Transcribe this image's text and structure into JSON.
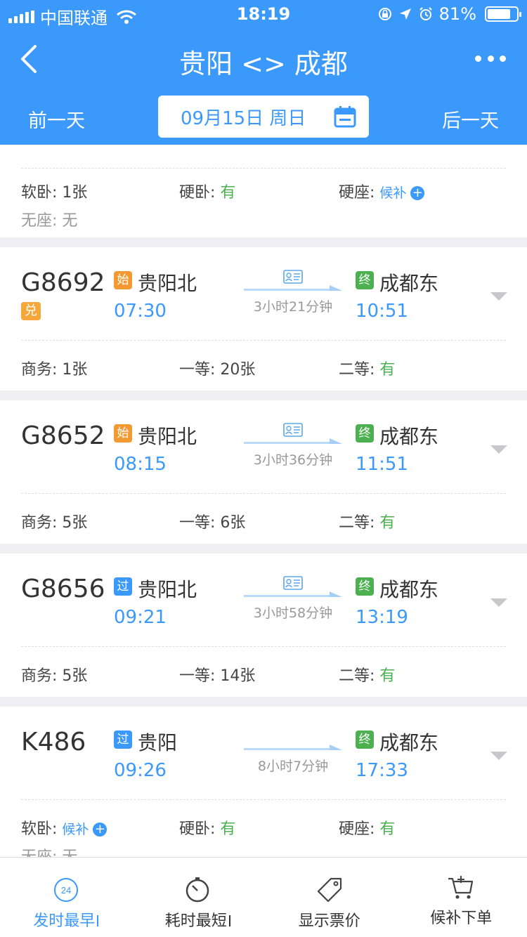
{
  "status": {
    "carrier": "中国联通",
    "time": "18:19",
    "battery": "81%",
    "battery_level": 0.81
  },
  "nav": {
    "title": "贵阳 <> 成都"
  },
  "datebar": {
    "prev": "前一天",
    "date": "09月15日 周日",
    "next": "后一天"
  },
  "partial_card": {
    "seats": [
      {
        "label": "软卧:",
        "value": "1张",
        "type": "normal"
      },
      {
        "label": "硬卧:",
        "value": "有",
        "type": "green"
      },
      {
        "label": "硬座:",
        "value": "候补",
        "type": "wait"
      }
    ],
    "seats2": [
      {
        "label": "无座:",
        "value": "无",
        "type": "gray"
      }
    ]
  },
  "trains": [
    {
      "no": "G8692",
      "exchange": "兑",
      "dep_badge": "始",
      "dep_badge_color": "orange",
      "dep_station": "贵阳北",
      "dep_time": "07:30",
      "duration": "3小时21分钟",
      "id_icon": true,
      "arr_badge": "终",
      "arr_station": "成都东",
      "arr_time": "10:51",
      "seats": [
        {
          "label": "商务:",
          "value": "1张",
          "type": "normal"
        },
        {
          "label": "一等:",
          "value": "20张",
          "type": "normal"
        },
        {
          "label": "二等:",
          "value": "有",
          "type": "green"
        }
      ]
    },
    {
      "no": "G8652",
      "exchange": "",
      "dep_badge": "始",
      "dep_badge_color": "orange",
      "dep_station": "贵阳北",
      "dep_time": "08:15",
      "duration": "3小时36分钟",
      "id_icon": true,
      "arr_badge": "终",
      "arr_station": "成都东",
      "arr_time": "11:51",
      "seats": [
        {
          "label": "商务:",
          "value": "5张",
          "type": "normal"
        },
        {
          "label": "一等:",
          "value": "6张",
          "type": "normal"
        },
        {
          "label": "二等:",
          "value": "有",
          "type": "green"
        }
      ]
    },
    {
      "no": "G8656",
      "exchange": "",
      "dep_badge": "过",
      "dep_badge_color": "blue",
      "dep_station": "贵阳北",
      "dep_time": "09:21",
      "duration": "3小时58分钟",
      "id_icon": true,
      "arr_badge": "终",
      "arr_station": "成都东",
      "arr_time": "13:19",
      "seats": [
        {
          "label": "商务:",
          "value": "5张",
          "type": "normal"
        },
        {
          "label": "一等:",
          "value": "14张",
          "type": "normal"
        },
        {
          "label": "二等:",
          "value": "有",
          "type": "green"
        }
      ]
    },
    {
      "no": "K486",
      "exchange": "",
      "dep_badge": "过",
      "dep_badge_color": "blue",
      "dep_station": "贵阳",
      "dep_time": "09:26",
      "duration": "8小时7分钟",
      "id_icon": false,
      "arr_badge": "终",
      "arr_station": "成都东",
      "arr_time": "17:33",
      "seats": [
        {
          "label": "软卧:",
          "value": "候补",
          "type": "wait"
        },
        {
          "label": "硬卧:",
          "value": "有",
          "type": "green"
        },
        {
          "label": "硬座:",
          "value": "有",
          "type": "green"
        }
      ],
      "seats2": [
        {
          "label": "无座:",
          "value": "无",
          "type": "gray"
        }
      ]
    }
  ],
  "tabs": [
    {
      "label": "发时最早",
      "icon": "clock-24-icon",
      "active": true,
      "sortable": true
    },
    {
      "label": "耗时最短",
      "icon": "timer-icon",
      "active": false,
      "sortable": true
    },
    {
      "label": "显示票价",
      "icon": "price-tag-icon",
      "active": false,
      "sortable": false
    },
    {
      "label": "候补下单",
      "icon": "cart-plus-icon",
      "active": false,
      "sortable": false
    }
  ],
  "colors": {
    "primary": "#3b99fc",
    "green": "#4cb051",
    "orange": "#f29a31"
  }
}
